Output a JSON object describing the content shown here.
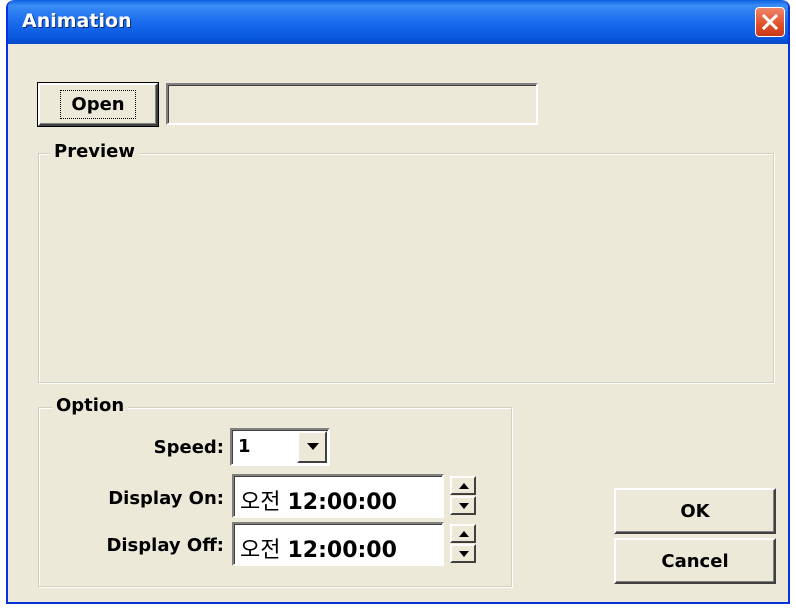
{
  "window": {
    "title": "Animation"
  },
  "file": {
    "open_label": "Open",
    "path_value": ""
  },
  "preview": {
    "label": "Preview"
  },
  "option": {
    "label": "Option",
    "speed_label": "Speed:",
    "speed_value": "1",
    "display_on_label": "Display On:",
    "display_on_ampm": "오전",
    "display_on_time": "12:00:00",
    "display_off_label": "Display Off:",
    "display_off_ampm": "오전",
    "display_off_time": "12:00:00"
  },
  "actions": {
    "ok_label": "OK",
    "cancel_label": "Cancel"
  },
  "colors": {
    "titlebar": "#0a5fe0",
    "dialog_bg": "#ece9d8",
    "close_button": "#e0502a"
  },
  "icons": {
    "close": "close-icon",
    "dropdown": "chevron-down-icon",
    "spin_up": "spin-up-icon",
    "spin_down": "spin-down-icon"
  }
}
